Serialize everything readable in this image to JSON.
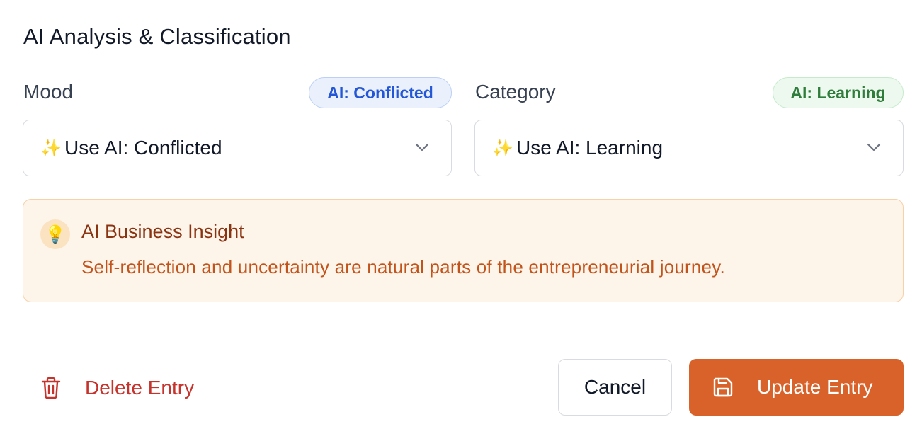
{
  "section": {
    "title": "AI Analysis & Classification"
  },
  "mood": {
    "label": "Mood",
    "ai_badge": "AI: Conflicted",
    "selected": "Use AI: Conflicted",
    "sparkle": "✨"
  },
  "category": {
    "label": "Category",
    "ai_badge": "AI: Learning",
    "selected": "Use AI: Learning",
    "sparkle": "✨"
  },
  "insight": {
    "icon": "💡",
    "title": "AI Business Insight",
    "text": "Self-reflection and uncertainty are natural parts of the entrepreneurial journey."
  },
  "actions": {
    "delete_label": "Delete Entry",
    "cancel_label": "Cancel",
    "update_label": "Update Entry"
  },
  "colors": {
    "accent": "#d9622b",
    "danger": "#c6322c",
    "mood_badge": "#2357d6",
    "category_badge": "#2f7d3b",
    "insight_bg": "#fdf4ea"
  },
  "icons": {
    "chevron": "chevron-down-icon",
    "bulb": "lightbulb-icon",
    "trash": "trash-icon",
    "save": "save-icon",
    "sparkle": "sparkles-icon"
  }
}
